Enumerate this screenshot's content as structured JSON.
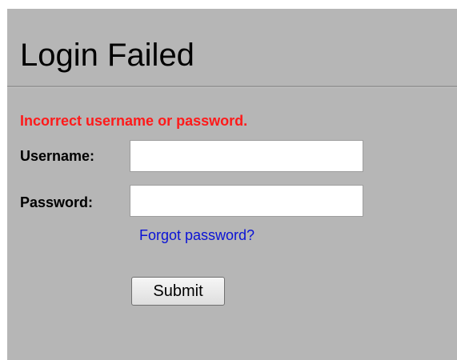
{
  "page": {
    "title": "Login Failed"
  },
  "login_form": {
    "error_message": "Incorrect username or password.",
    "username_label": "Username:",
    "username_value": "",
    "password_label": "Password:",
    "password_value": "",
    "forgot_password_link": "Forgot password?",
    "submit_label": "Submit"
  },
  "colors": {
    "background": "#b6b6b6",
    "error_text": "#ff1a1a",
    "link_text": "#0a12d6"
  }
}
